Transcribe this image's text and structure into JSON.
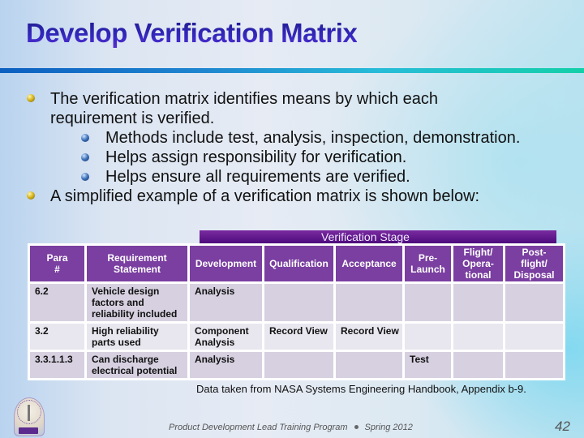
{
  "slide": {
    "title": "Develop Verification Matrix",
    "bullets": [
      {
        "level": 1,
        "text_line1": "The verification matrix identifies means by which each",
        "text_line2": "requirement is verified."
      },
      {
        "level": 2,
        "text": "Methods include test, analysis, inspection, demonstration."
      },
      {
        "level": 2,
        "text": "Helps assign responsibility for verification."
      },
      {
        "level": 2,
        "text": "Helps ensure all requirements are verified."
      },
      {
        "level": 1,
        "text": "A simplified example of a verification matrix is shown below:"
      }
    ],
    "table": {
      "group_header": "Verification Stage",
      "headers": [
        "Para #",
        "Requirement Statement",
        "Development",
        "Qualification",
        "Acceptance",
        "Pre-Launch",
        "Flight/ Opera-tional",
        "Post-flight/ Disposal"
      ],
      "header_lines": [
        [
          "Para",
          "#"
        ],
        [
          "Requirement",
          "Statement"
        ],
        [
          "Development"
        ],
        [
          "Qualification"
        ],
        [
          "Acceptance"
        ],
        [
          "Pre-",
          "Launch"
        ],
        [
          "Flight/",
          "Opera-",
          "tional"
        ],
        [
          "Post-",
          "flight/",
          "Disposal"
        ]
      ],
      "rows": [
        [
          "6.2",
          "Vehicle design factors and reliability included",
          "Analysis",
          "",
          "",
          "",
          "",
          ""
        ],
        [
          "3.2",
          "High reliability parts used",
          "Component Analysis",
          "Record View",
          "Record View",
          "",
          "",
          ""
        ],
        [
          "3.3.1.1.3",
          "Can discharge electrical potential",
          "Analysis",
          "",
          "",
          "Test",
          "",
          ""
        ]
      ]
    },
    "source_note": "Data taken from NASA Systems Engineering Handbook, Appendix b-9.",
    "footer": {
      "program": "Product Development Lead Training Program",
      "term": "Spring 2012",
      "page_number": "42"
    },
    "logo_icon": "program-seal-logo",
    "colors": {
      "title": "#2a1fa0",
      "header_bg": "#7a3fa0",
      "stage_band": "#4a0a7a",
      "row_dark": "#d6d0e0",
      "row_light": "#e8e6ee",
      "rule_start": "#0c5fc0",
      "rule_end": "#14cfa8"
    }
  }
}
